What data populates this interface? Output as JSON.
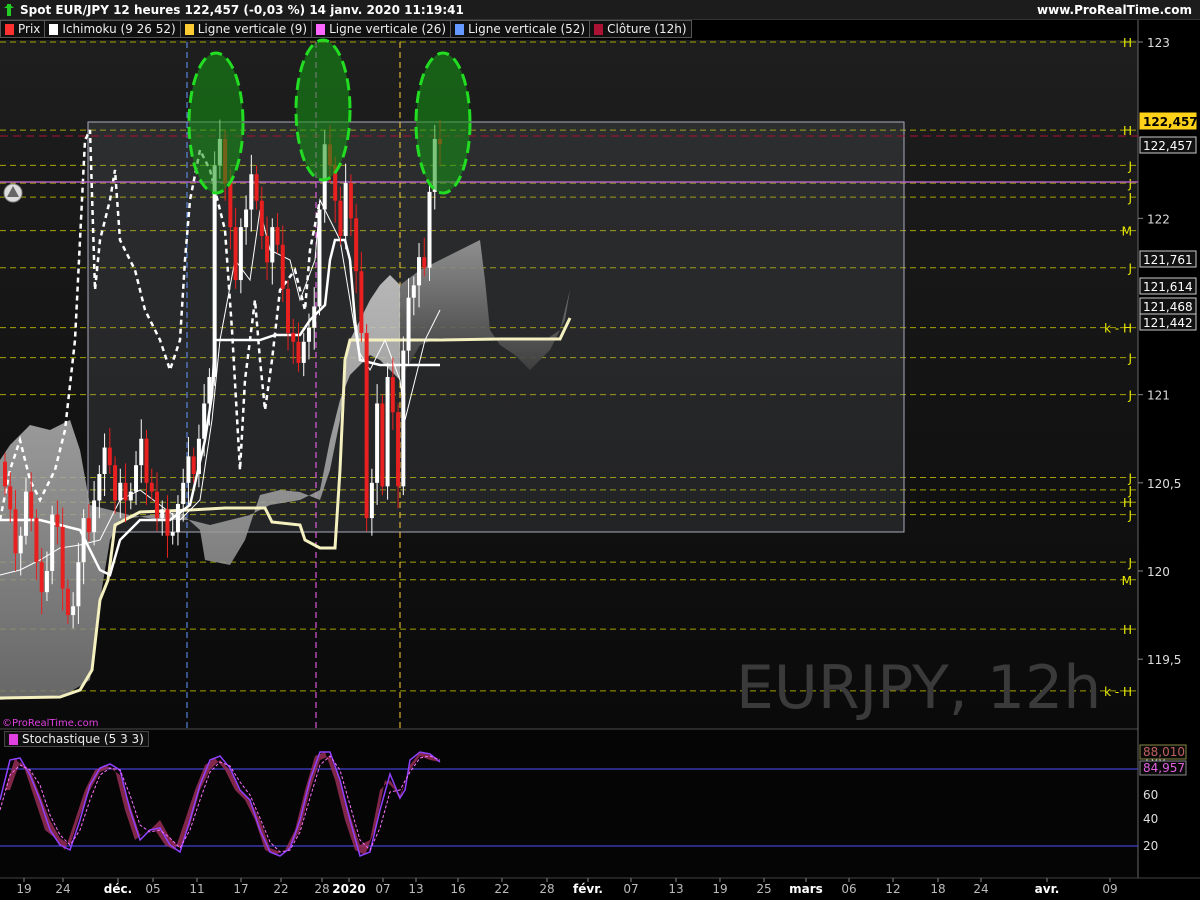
{
  "header": {
    "title": "Spot EUR/JPY 12 heures 122,457 (-0,03 %) 14 janv. 2020 11:19:41",
    "brand": "www.ProRealTime.com"
  },
  "legend": [
    {
      "label": "Prix",
      "color": "#ff3030"
    },
    {
      "label": "Ichimoku (9 26 52)",
      "color": "#ffffff"
    },
    {
      "label": "Ligne verticale (9)",
      "color": "#ffcc33"
    },
    {
      "label": "Ligne verticale (26)",
      "color": "#ff66ff"
    },
    {
      "label": "Ligne verticale (52)",
      "color": "#6699ff"
    },
    {
      "label": "Clôture (12h)",
      "color": "#aa1133"
    }
  ],
  "watermark": "EURJPY, 12h",
  "small_brand": "©ProRealTime.com",
  "stoch_title": "Stochastique (5 3 3)",
  "colors": {
    "up": "#ffffff",
    "down": "#e82020",
    "level": "#d4d400",
    "cloud": "#bdbdbd",
    "green": "#22cc22"
  },
  "chart_data": {
    "type": "candlestick",
    "instrument": "EUR/JPY",
    "timeframe": "12h",
    "last": 122.457,
    "y_ticks": [
      "123",
      "122",
      "121",
      "120,5",
      "120",
      "119,5"
    ],
    "ylim": [
      119.3,
      123.1
    ],
    "price_labels": [
      "122,457",
      "122,457",
      "121,761",
      "121,614",
      "121,468",
      "121,442"
    ],
    "levels": [
      {
        "value": 123.0,
        "tag": "H"
      },
      {
        "value": 122.5,
        "tag": "H"
      },
      {
        "value": 122.3,
        "tag": "J"
      },
      {
        "value": 122.2,
        "tag": "J"
      },
      {
        "value": 122.12,
        "tag": "J"
      },
      {
        "value": 121.93,
        "tag": "M"
      },
      {
        "value": 121.72,
        "tag": "J"
      },
      {
        "value": 121.38,
        "tag": "k - H"
      },
      {
        "value": 121.21,
        "tag": "J"
      },
      {
        "value": 121.0,
        "tag": "J"
      },
      {
        "value": 120.53,
        "tag": "J"
      },
      {
        "value": 120.46,
        "tag": "J"
      },
      {
        "value": 120.39,
        "tag": "H"
      },
      {
        "value": 120.32,
        "tag": "J"
      },
      {
        "value": 120.05,
        "tag": "J"
      },
      {
        "value": 119.95,
        "tag": "M"
      },
      {
        "value": 119.67,
        "tag": "H"
      },
      {
        "value": 119.32,
        "tag": "k - H"
      }
    ],
    "x_ticks": [
      "19",
      "24",
      "déc.",
      "05",
      "11",
      "17",
      "22",
      "28",
      "2020",
      "07",
      "13",
      "16",
      "22",
      "28",
      "févr.",
      "07",
      "13",
      "19",
      "25",
      "mars",
      "06",
      "12",
      "18",
      "24",
      "avr.",
      "09"
    ],
    "candles": [
      [
        120.62,
        120.48
      ],
      [
        120.48,
        120.35
      ],
      [
        120.35,
        120.1
      ],
      [
        120.1,
        120.2
      ],
      [
        120.2,
        120.45
      ],
      [
        120.45,
        120.3
      ],
      [
        120.3,
        120.05
      ],
      [
        120.05,
        119.88
      ],
      [
        119.88,
        120.0
      ],
      [
        120.0,
        120.32
      ],
      [
        120.32,
        120.25
      ],
      [
        120.25,
        119.9
      ],
      [
        119.9,
        119.75
      ],
      [
        119.75,
        119.8
      ],
      [
        119.8,
        120.05
      ],
      [
        120.05,
        120.3
      ],
      [
        120.3,
        120.22
      ],
      [
        120.22,
        120.4
      ],
      [
        120.4,
        120.55
      ],
      [
        120.55,
        120.7
      ],
      [
        120.7,
        120.6
      ],
      [
        120.6,
        120.4
      ],
      [
        120.4,
        120.5
      ],
      [
        120.5,
        120.4
      ],
      [
        120.4,
        120.45
      ],
      [
        120.45,
        120.6
      ],
      [
        120.6,
        120.75
      ],
      [
        120.75,
        120.5
      ],
      [
        120.5,
        120.45
      ],
      [
        120.45,
        120.3
      ],
      [
        120.3,
        120.35
      ],
      [
        120.35,
        120.2
      ],
      [
        120.2,
        120.22
      ],
      [
        120.22,
        120.38
      ],
      [
        120.38,
        120.5
      ],
      [
        120.5,
        120.65
      ],
      [
        120.65,
        120.55
      ],
      [
        120.55,
        120.75
      ],
      [
        120.75,
        120.95
      ],
      [
        120.95,
        121.1
      ],
      [
        121.1,
        122.3
      ],
      [
        122.3,
        122.45
      ],
      [
        122.45,
        122.2
      ],
      [
        122.2,
        121.95
      ],
      [
        121.95,
        121.65
      ],
      [
        121.65,
        121.95
      ],
      [
        121.95,
        122.05
      ],
      [
        122.05,
        122.25
      ],
      [
        122.25,
        122.1
      ],
      [
        122.1,
        121.9
      ],
      [
        121.9,
        121.75
      ],
      [
        121.75,
        121.95
      ],
      [
        121.95,
        121.85
      ],
      [
        121.85,
        121.6
      ],
      [
        121.6,
        121.35
      ],
      [
        121.35,
        121.3
      ],
      [
        121.3,
        121.18
      ],
      [
        121.18,
        121.3
      ],
      [
        121.3,
        121.38
      ],
      [
        121.38,
        121.5
      ],
      [
        121.5,
        122.05
      ],
      [
        122.05,
        122.42
      ],
      [
        122.42,
        122.3
      ],
      [
        122.3,
        122.1
      ],
      [
        122.1,
        121.9
      ],
      [
        121.9,
        122.2
      ],
      [
        122.2,
        122.0
      ],
      [
        122.0,
        121.7
      ],
      [
        121.7,
        121.35
      ],
      [
        121.35,
        120.3
      ],
      [
        120.3,
        120.5
      ],
      [
        120.5,
        120.95
      ],
      [
        120.95,
        120.48
      ],
      [
        120.48,
        121.1
      ],
      [
        121.1,
        120.9
      ],
      [
        120.9,
        120.48
      ],
      [
        120.48,
        121.25
      ],
      [
        121.25,
        121.55
      ],
      [
        121.55,
        121.62
      ],
      [
        121.62,
        121.78
      ],
      [
        121.78,
        121.72
      ],
      [
        121.72,
        122.15
      ],
      [
        122.15,
        122.45
      ],
      [
        122.45,
        122.42
      ]
    ]
  }
}
